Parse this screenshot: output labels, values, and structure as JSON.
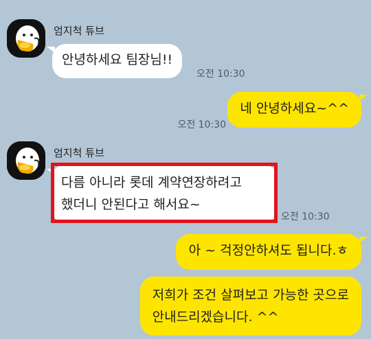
{
  "colors": {
    "background": "#b3c6d6",
    "incoming_bubble": "#ffffff",
    "outgoing_bubble": "#fee500",
    "highlight_border": "#e1141c"
  },
  "messages": [
    {
      "sender": "엄지척 튜브",
      "avatar": "tube-character-avatar",
      "text": "안녕하세요 팀장님!!",
      "time": "오전 10:30",
      "direction": "incoming"
    },
    {
      "text": "네 안녕하세요~^^",
      "time": "오전 10:30",
      "direction": "outgoing"
    },
    {
      "sender": "엄지척 튜브",
      "avatar": "tube-character-avatar",
      "lines": [
        "다름 아니라 롯데 계약연장하려고",
        "했더니 안된다고 해서요~"
      ],
      "time": "오전 10:30",
      "direction": "incoming",
      "highlighted": true
    },
    {
      "text": "아 ~ 걱정안하셔도 됩니다.ㅎ",
      "direction": "outgoing"
    },
    {
      "lines": [
        "저희가 조건 살펴보고 가능한 곳으로",
        "안내드리겠습니다. ^^"
      ],
      "direction": "outgoing"
    }
  ]
}
